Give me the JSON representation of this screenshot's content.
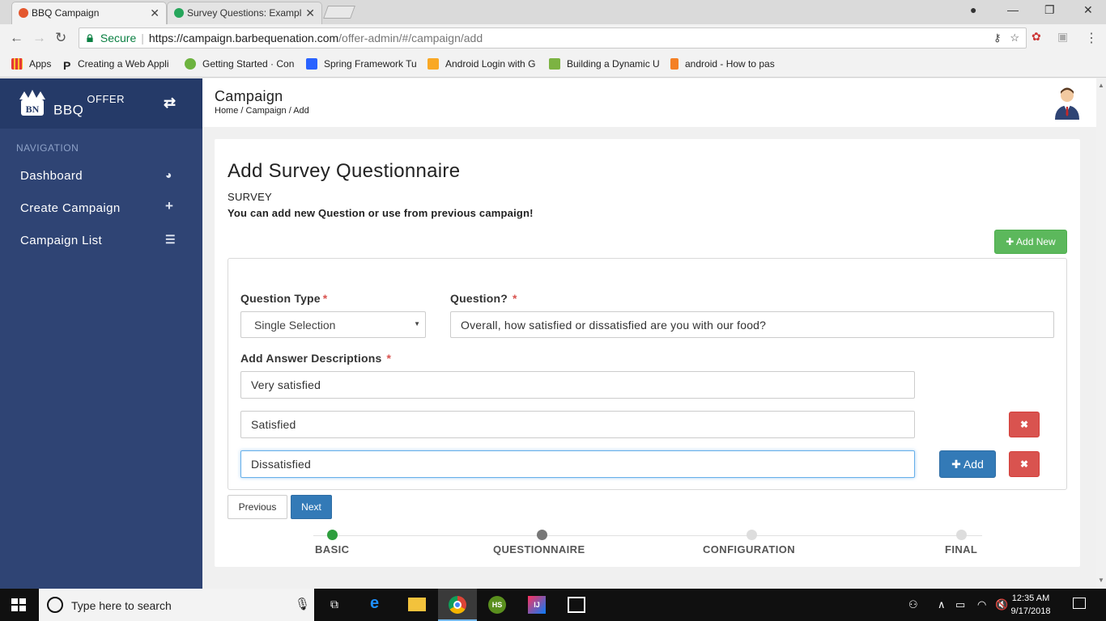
{
  "browser": {
    "tabs": [
      {
        "title": "BBQ Campaign",
        "favicon_color": "#e4572e"
      },
      {
        "title": "Survey Questions: Exampl",
        "favicon_color": "#26a65b"
      }
    ],
    "address": {
      "secure_label": "Secure",
      "url_host": "https://campaign.barbequenation.com",
      "url_path": "/offer-admin/#/campaign/add"
    },
    "bookmarks": [
      {
        "label": "Apps",
        "icon": "apps-grid-icon"
      },
      {
        "label": "Creating a Web Appli",
        "icon": "p-icon"
      },
      {
        "label": "Getting Started · Con",
        "icon": "spring-icon"
      },
      {
        "label": "Spring Framework Tu",
        "icon": "spring-framework-icon"
      },
      {
        "label": "Android Login with G",
        "icon": "bookmark-star-icon"
      },
      {
        "label": "Building a Dynamic U",
        "icon": "android-icon"
      },
      {
        "label": "android - How to pas",
        "icon": "stackoverflow-icon"
      }
    ]
  },
  "sidebar": {
    "brand": "BBQ",
    "brand_sup": "OFFER",
    "logo_text": "BN",
    "nav_title": "NAVIGATION",
    "items": [
      {
        "label": "Dashboard",
        "icon": "dashboard-icon"
      },
      {
        "label": "Create Campaign",
        "icon": "plus-icon"
      },
      {
        "label": "Campaign List",
        "icon": "list-icon"
      }
    ]
  },
  "header": {
    "title": "Campaign",
    "breadcrumb": "Home / Campaign / Add"
  },
  "form": {
    "title": "Add Survey Questionnaire",
    "section_label": "SURVEY",
    "section_sub": "You can add new Question or use from previous campaign!",
    "add_new_label": "Add New",
    "question_type_label": "Question Type",
    "question_type_value": "Single Selection",
    "question_label": "Question?",
    "question_value": "Overall, how satisfied or dissatisfied are you with our food?",
    "answers_label": "Add Answer Descriptions",
    "required_mark": "*",
    "answers": [
      "Very satisfied",
      "Satisfied",
      "Dissatisfied"
    ],
    "add_label": "Add",
    "delete_glyph": "✖",
    "previous_label": "Previous",
    "next_label": "Next"
  },
  "steps": [
    {
      "label": "BASIC",
      "state": "done",
      "color": "#2e9e3e"
    },
    {
      "label": "QUESTIONNAIRE",
      "state": "current",
      "color": "#777777"
    },
    {
      "label": "CONFIGURATION",
      "state": "todo",
      "color": "#dddddd"
    },
    {
      "label": "FINAL",
      "state": "todo",
      "color": "#dddddd"
    }
  ],
  "taskbar": {
    "search_placeholder": "Type here to search",
    "time": "12:35 AM",
    "date": "9/17/2018"
  },
  "colors": {
    "sidebar": "#2f4474",
    "primary": "#337ab7",
    "success": "#5cb85c",
    "danger": "#d9534f"
  }
}
